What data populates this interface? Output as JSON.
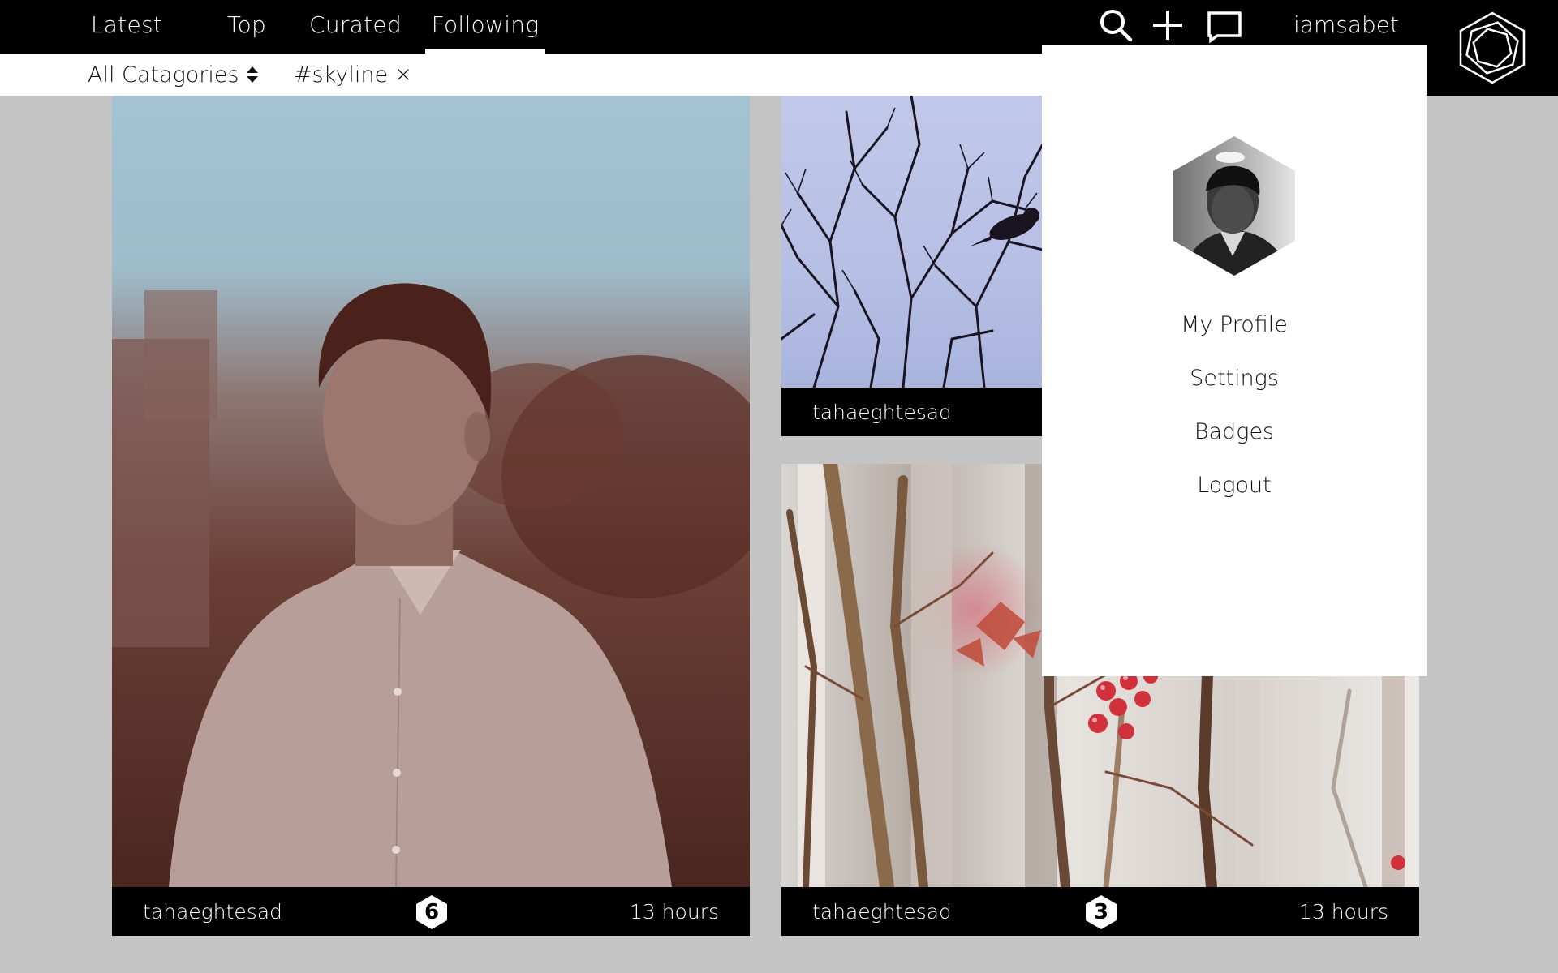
{
  "nav": {
    "tabs": [
      {
        "label": "Latest"
      },
      {
        "label": "Top"
      },
      {
        "label": "Curated"
      },
      {
        "label": "Following",
        "active": true
      }
    ],
    "icons": [
      "search-icon",
      "plus-icon",
      "message-icon"
    ],
    "username": "iamsabet"
  },
  "filter": {
    "category": "All Catagories",
    "tag": "#skyline",
    "tag_remove": "×"
  },
  "posts": [
    {
      "author": "tahaeghtesad",
      "badge": "6",
      "time": "13 hours"
    },
    {
      "author": "tahaeghtesad"
    },
    {
      "author": "tahaeghtesad",
      "badge": "3",
      "time": "13 hours"
    }
  ],
  "menu": {
    "items": [
      {
        "label": "My Profile"
      },
      {
        "label": "Settings"
      },
      {
        "label": "Badges"
      },
      {
        "label": "Logout"
      }
    ]
  },
  "colors": {
    "bar": "#000000",
    "background": "#c4c4c4",
    "panel": "#ffffff"
  }
}
